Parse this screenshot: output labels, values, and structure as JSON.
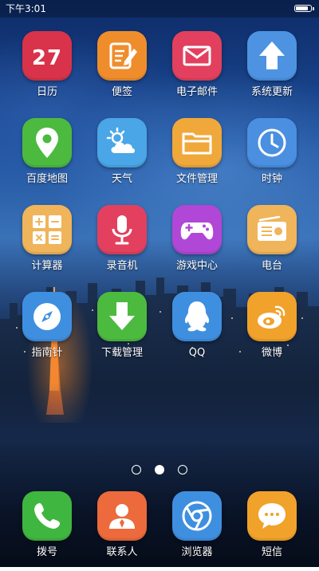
{
  "status_bar": {
    "time": "下午3:01",
    "battery_level": 0.9
  },
  "page_indicator": {
    "pages": 3,
    "current": 2
  },
  "apps": [
    {
      "label": "日历",
      "icon": "calendar-icon",
      "bg": "#d8334a",
      "date_text": "27"
    },
    {
      "label": "便签",
      "icon": "notes-icon",
      "bg": "#ef8d2c"
    },
    {
      "label": "电子邮件",
      "icon": "email-icon",
      "bg": "#e2405e"
    },
    {
      "label": "系统更新",
      "icon": "system-update-icon",
      "bg": "#4d93e2"
    },
    {
      "label": "百度地图",
      "icon": "map-pin-icon",
      "bg": "#4cba3f"
    },
    {
      "label": "天气",
      "icon": "weather-icon",
      "bg": "#4aa6e6"
    },
    {
      "label": "文件管理",
      "icon": "folder-icon",
      "bg": "#f0a83a"
    },
    {
      "label": "时钟",
      "icon": "clock-icon",
      "bg": "#4b8fe0"
    },
    {
      "label": "计算器",
      "icon": "calculator-icon",
      "bg": "#f0b45a"
    },
    {
      "label": "录音机",
      "icon": "microphone-icon",
      "bg": "#e2405e"
    },
    {
      "label": "游戏中心",
      "icon": "gamepad-icon",
      "bg": "#b047d6"
    },
    {
      "label": "电台",
      "icon": "radio-icon",
      "bg": "#f0b45a"
    },
    {
      "label": "指南针",
      "icon": "compass-icon",
      "bg": "#3f8fe0"
    },
    {
      "label": "下载管理",
      "icon": "download-icon",
      "bg": "#4cba3f"
    },
    {
      "label": "QQ",
      "icon": "qq-icon",
      "bg": "#3f8fe0"
    },
    {
      "label": "微博",
      "icon": "weibo-icon",
      "bg": "#f0a22a"
    }
  ],
  "dock": [
    {
      "label": "拨号",
      "icon": "phone-icon",
      "bg": "#3fb63f"
    },
    {
      "label": "联系人",
      "icon": "contacts-icon",
      "bg": "#ec6a3c"
    },
    {
      "label": "浏览器",
      "icon": "browser-icon",
      "bg": "#3f8fe0"
    },
    {
      "label": "短信",
      "icon": "messages-icon",
      "bg": "#f0a22a"
    }
  ]
}
